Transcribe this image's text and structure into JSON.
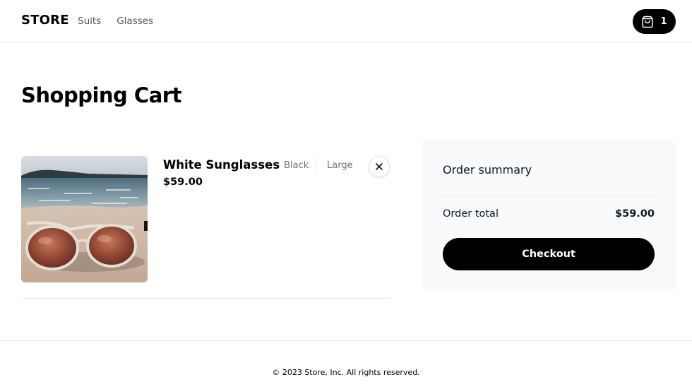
{
  "header": {
    "logo": "STORE",
    "nav": [
      {
        "label": "Suits"
      },
      {
        "label": "Glasses"
      }
    ],
    "cart": {
      "icon": "shopping-bag-icon",
      "count": "1"
    }
  },
  "main": {
    "title": "Shopping Cart",
    "items": [
      {
        "name": "White Sunglasses",
        "price": "$59.00",
        "color": "Black",
        "size": "Large",
        "image": "sunglasses-on-beach-photo",
        "remove_icon": "close-icon"
      }
    ]
  },
  "summary": {
    "title": "Order summary",
    "total_label": "Order total",
    "total_value": "$59.00",
    "checkout_label": "Checkout"
  },
  "footer": {
    "copyright": "© 2023 Store, Inc. All rights reserved."
  },
  "colors": {
    "accent": "#000000",
    "muted_text": "#6b7280",
    "summary_bg": "#f9fafb",
    "border": "#e5e7eb"
  }
}
